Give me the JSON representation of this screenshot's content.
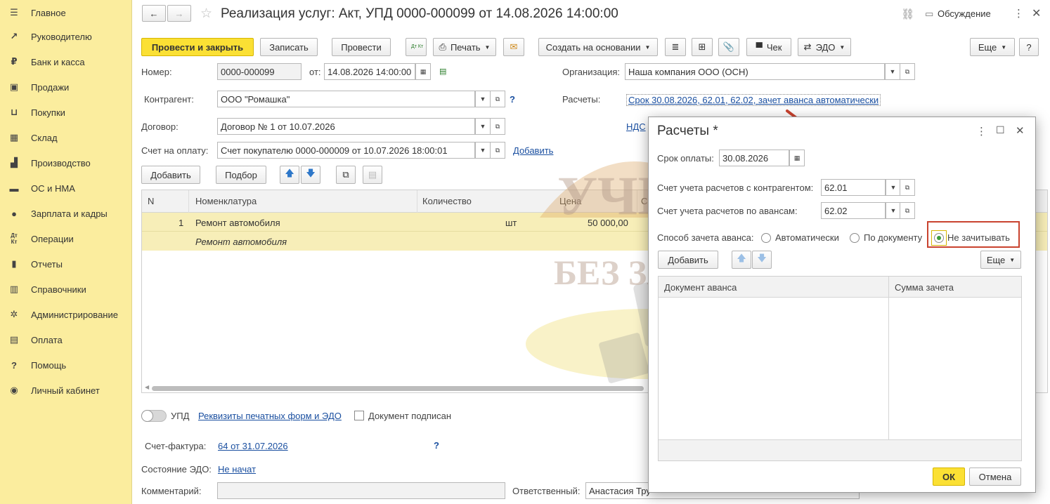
{
  "sidebar": {
    "items": [
      {
        "label": "Главное",
        "icon": "menu-icon"
      },
      {
        "label": "Руководителю",
        "icon": "trend-icon"
      },
      {
        "label": "Банк и касса",
        "icon": "coin-icon"
      },
      {
        "label": "Продажи",
        "icon": "bag-icon"
      },
      {
        "label": "Покупки",
        "icon": "cart-icon"
      },
      {
        "label": "Склад",
        "icon": "warehouse-icon"
      },
      {
        "label": "Производство",
        "icon": "factory-icon"
      },
      {
        "label": "ОС и НМА",
        "icon": "truck-icon"
      },
      {
        "label": "Зарплата и кадры",
        "icon": "person-icon"
      },
      {
        "label": "Операции",
        "icon": "dt-kt-icon"
      },
      {
        "label": "Отчеты",
        "icon": "bar-chart-icon"
      },
      {
        "label": "Справочники",
        "icon": "books-icon"
      },
      {
        "label": "Администрирование",
        "icon": "gear-icon"
      },
      {
        "label": "Оплата",
        "icon": "wallet-icon"
      },
      {
        "label": "Помощь",
        "icon": "question-icon"
      },
      {
        "label": "Личный кабинет",
        "icon": "account-icon"
      }
    ]
  },
  "header": {
    "title": "Реализация услуг: Акт, УПД 0000-000099 от 14.08.2026 14:00:00",
    "discussion": "Обсуждение"
  },
  "toolbar": {
    "post_close": "Провести и закрыть",
    "save": "Записать",
    "post": "Провести",
    "dtkt": "Дт Кт",
    "print": "Печать",
    "create_based": "Создать на основании",
    "check": "Чек",
    "edo": "ЭДО",
    "more": "Еще",
    "help": "?"
  },
  "form": {
    "number_label": "Номер:",
    "number": "0000-000099",
    "date_label": "от:",
    "date": "14.08.2026 14:00:00",
    "org_label": "Организация:",
    "org": "Наша компания ООО (ОСН)",
    "counterparty_label": "Контрагент:",
    "counterparty": "ООО \"Ромашка\"",
    "settlements_label": "Расчеты:",
    "settlements_link": "Срок 30.08.2026, 62.01, 62.02, зачет аванса автоматически",
    "contract_label": "Договор:",
    "contract": "Договор № 1 от 10.07.2026",
    "vat_link": "НДС",
    "invoice_label": "Счет на оплату:",
    "invoice": "Счет покупателю 0000-000009 от 10.07.2026 18:00:01",
    "add_link": "Добавить",
    "help_q": "?"
  },
  "table_toolbar": {
    "add": "Добавить",
    "pick": "Подбор"
  },
  "table": {
    "columns": [
      "N",
      "Номенклатура",
      "Количество",
      "Цена",
      "С"
    ],
    "rows": [
      {
        "n": "1",
        "item": "Ремонт автомобиля",
        "item_sub": "Ремонт автомобиля",
        "unit": "шт",
        "price": "50 000,00"
      }
    ]
  },
  "watermark": {
    "line1": "УЧЕТ",
    "line2": "БЕЗ ЗАБОТ"
  },
  "footer": {
    "upd_label": "УПД",
    "print_forms_link": "Реквизиты печатных форм и ЭДО",
    "signed_label": "Документ подписан",
    "sf_label": "Счет-фактура:",
    "sf_link": "64 от 31.07.2026",
    "sf_help": "?",
    "edo_state_label": "Состояние ЭДО:",
    "edo_state_link": "Не начат",
    "comment_label": "Комментарий:",
    "comment": "",
    "responsible_label": "Ответственный:",
    "responsible": "Анастасия Тру"
  },
  "dialog": {
    "title": "Расчеты *",
    "due_label": "Срок оплаты:",
    "due_date": "30.08.2026",
    "acc_counterparty_label": "Счет учета расчетов с контрагентом:",
    "acc_counterparty": "62.01",
    "acc_advance_label": "Счет учета расчетов по авансам:",
    "acc_advance": "62.02",
    "offset_label": "Способ зачета аванса:",
    "options": [
      "Автоматически",
      "По документу",
      "Не зачитывать"
    ],
    "selected_option": "Не зачитывать",
    "add": "Добавить",
    "more": "Еще",
    "columns": [
      "Документ аванса",
      "Сумма зачета"
    ],
    "ok": "ОК",
    "cancel": "Отмена"
  },
  "colors": {
    "sidebar_bg": "#fbed9e",
    "primary_button": "#fbe034",
    "selected_row": "#f7eeb8",
    "link": "#1a4fa0",
    "annotation_red": "#c9432f"
  }
}
